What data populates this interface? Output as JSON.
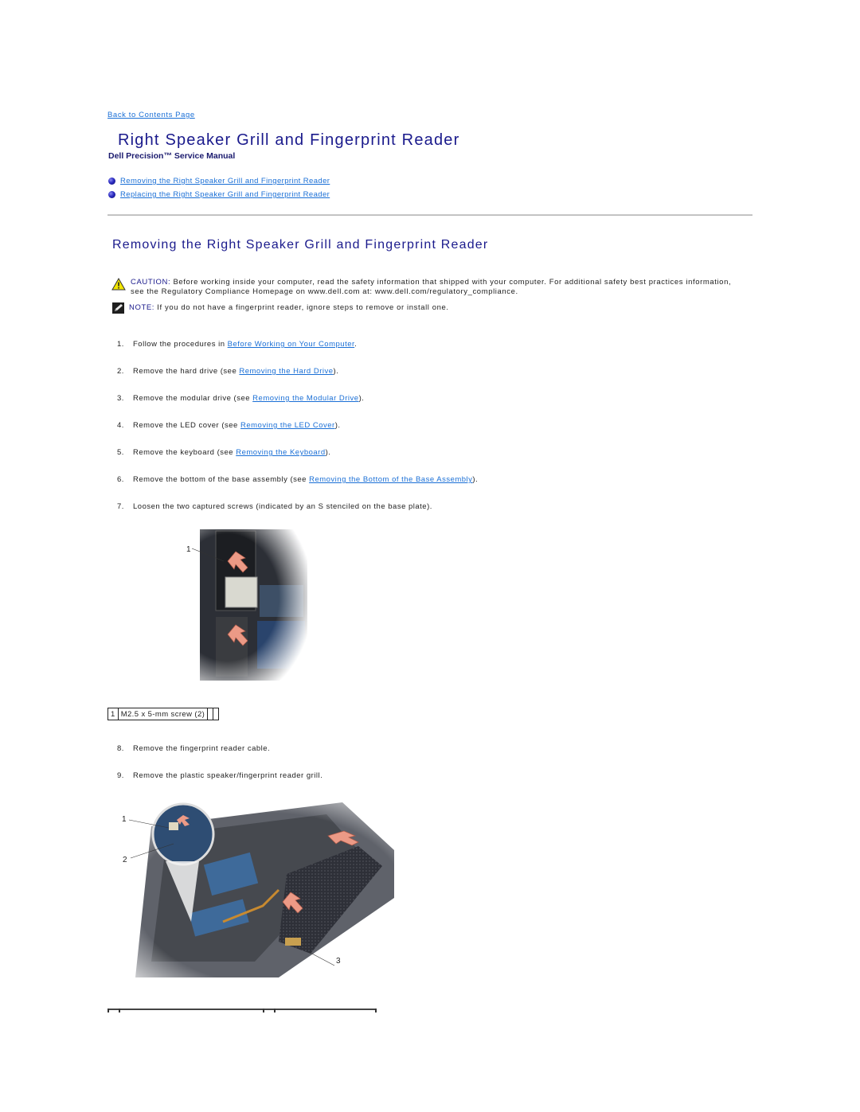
{
  "nav": {
    "back_link": "Back to Contents Page"
  },
  "header": {
    "title": "Right Speaker Grill and Fingerprint Reader",
    "subtitle": "Dell Precision™ Service Manual"
  },
  "toc": [
    {
      "label": "Removing the Right Speaker Grill and Fingerprint Reader"
    },
    {
      "label": "Replacing the Right Speaker Grill and Fingerprint Reader"
    }
  ],
  "section": {
    "title": "Removing the Right Speaker Grill and Fingerprint Reader",
    "caution": {
      "label": "CAUTION:",
      "text": "Before working inside your computer, read the safety information that shipped with your computer. For additional safety best practices information, see the Regulatory Compliance Homepage on www.dell.com at: www.dell.com/regulatory_compliance."
    },
    "note": {
      "label": "NOTE:",
      "text": "If you do not have a fingerprint reader, ignore steps to remove or install one."
    },
    "steps": [
      {
        "num": "1.",
        "pre": "Follow the procedures in ",
        "link": "Before Working on Your Computer",
        "post": "."
      },
      {
        "num": "2.",
        "pre": "Remove the hard drive (see ",
        "link": "Removing the Hard Drive",
        "post": ")."
      },
      {
        "num": "3.",
        "pre": "Remove the modular drive (see ",
        "link": "Removing the Modular Drive",
        "post": ")."
      },
      {
        "num": "4.",
        "pre": "Remove the LED cover (see ",
        "link": "Removing the LED Cover",
        "post": ")."
      },
      {
        "num": "5.",
        "pre": "Remove the keyboard (see ",
        "link": "Removing the Keyboard",
        "post": ")."
      },
      {
        "num": "6.",
        "pre": "Remove the bottom of the base assembly (see ",
        "link": "Removing the Bottom of the Base Assembly",
        "post": ")."
      },
      {
        "num": "7.",
        "pre": "Loosen the two captured screws (indicated by an S stenciled on the base plate).",
        "link": "",
        "post": ""
      }
    ],
    "figure1": {
      "callouts": [
        "1"
      ]
    },
    "screw_table": {
      "num": "1",
      "label": "M2.5 x 5-mm screw (2)"
    },
    "steps2": [
      {
        "num": "8.",
        "text": "Remove the fingerprint reader cable."
      },
      {
        "num": "9.",
        "text": "Remove the plastic speaker/fingerprint reader grill."
      }
    ],
    "figure2": {
      "callouts": [
        "1",
        "2",
        "3"
      ]
    }
  },
  "colors": {
    "heading": "#1a1a8c",
    "link": "#1a6fd6",
    "arrow": "#e8907a"
  }
}
